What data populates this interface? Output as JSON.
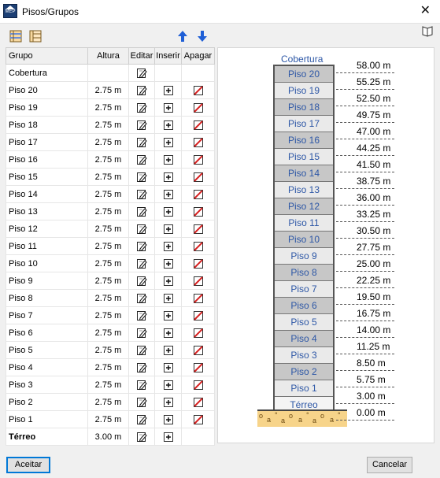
{
  "window": {
    "title": "Pisos/Grupos",
    "app_icon_text": "CYPE\nMEP"
  },
  "grid": {
    "headers": {
      "grupo": "Grupo",
      "altura": "Altura",
      "editar": "Editar",
      "inserir": "Inserir",
      "apagar": "Apagar"
    },
    "rows": [
      {
        "name": "Cobertura",
        "height": "",
        "bold": false,
        "edit": true,
        "insert": false,
        "delete": false
      },
      {
        "name": "Piso 20",
        "height": "2.75 m",
        "bold": false,
        "edit": true,
        "insert": true,
        "delete": true
      },
      {
        "name": "Piso 19",
        "height": "2.75 m",
        "bold": false,
        "edit": true,
        "insert": true,
        "delete": true
      },
      {
        "name": "Piso 18",
        "height": "2.75 m",
        "bold": false,
        "edit": true,
        "insert": true,
        "delete": true
      },
      {
        "name": "Piso 17",
        "height": "2.75 m",
        "bold": false,
        "edit": true,
        "insert": true,
        "delete": true
      },
      {
        "name": "Piso 16",
        "height": "2.75 m",
        "bold": false,
        "edit": true,
        "insert": true,
        "delete": true
      },
      {
        "name": "Piso 15",
        "height": "2.75 m",
        "bold": false,
        "edit": true,
        "insert": true,
        "delete": true
      },
      {
        "name": "Piso 14",
        "height": "2.75 m",
        "bold": false,
        "edit": true,
        "insert": true,
        "delete": true
      },
      {
        "name": "Piso 13",
        "height": "2.75 m",
        "bold": false,
        "edit": true,
        "insert": true,
        "delete": true
      },
      {
        "name": "Piso 12",
        "height": "2.75 m",
        "bold": false,
        "edit": true,
        "insert": true,
        "delete": true
      },
      {
        "name": "Piso 11",
        "height": "2.75 m",
        "bold": false,
        "edit": true,
        "insert": true,
        "delete": true
      },
      {
        "name": "Piso 10",
        "height": "2.75 m",
        "bold": false,
        "edit": true,
        "insert": true,
        "delete": true
      },
      {
        "name": "Piso 9",
        "height": "2.75 m",
        "bold": false,
        "edit": true,
        "insert": true,
        "delete": true
      },
      {
        "name": "Piso 8",
        "height": "2.75 m",
        "bold": false,
        "edit": true,
        "insert": true,
        "delete": true
      },
      {
        "name": "Piso 7",
        "height": "2.75 m",
        "bold": false,
        "edit": true,
        "insert": true,
        "delete": true
      },
      {
        "name": "Piso 6",
        "height": "2.75 m",
        "bold": false,
        "edit": true,
        "insert": true,
        "delete": true
      },
      {
        "name": "Piso 5",
        "height": "2.75 m",
        "bold": false,
        "edit": true,
        "insert": true,
        "delete": true
      },
      {
        "name": "Piso 4",
        "height": "2.75 m",
        "bold": false,
        "edit": true,
        "insert": true,
        "delete": true
      },
      {
        "name": "Piso 3",
        "height": "2.75 m",
        "bold": false,
        "edit": true,
        "insert": true,
        "delete": true
      },
      {
        "name": "Piso 2",
        "height": "2.75 m",
        "bold": false,
        "edit": true,
        "insert": true,
        "delete": true
      },
      {
        "name": "Piso 1",
        "height": "2.75 m",
        "bold": false,
        "edit": true,
        "insert": true,
        "delete": true
      },
      {
        "name": "Térreo",
        "height": "3.00 m",
        "bold": true,
        "edit": true,
        "insert": true,
        "delete": false
      }
    ]
  },
  "diagram": {
    "top_label": "Cobertura",
    "levels": [
      {
        "label": "Cobertura",
        "value": "58.00 m"
      },
      {
        "label": "Piso 20",
        "value": "55.25 m"
      },
      {
        "label": "Piso 19",
        "value": "52.50 m"
      },
      {
        "label": "Piso 18",
        "value": "49.75 m"
      },
      {
        "label": "Piso 17",
        "value": "47.00 m"
      },
      {
        "label": "Piso 16",
        "value": "44.25 m"
      },
      {
        "label": "Piso 15",
        "value": "41.50 m"
      },
      {
        "label": "Piso 14",
        "value": "38.75 m"
      },
      {
        "label": "Piso 13",
        "value": "36.00 m"
      },
      {
        "label": "Piso 12",
        "value": "33.25 m"
      },
      {
        "label": "Piso 11",
        "value": "30.50 m"
      },
      {
        "label": "Piso 10",
        "value": "27.75 m"
      },
      {
        "label": "Piso 9",
        "value": "25.00 m"
      },
      {
        "label": "Piso 8",
        "value": "22.25 m"
      },
      {
        "label": "Piso 7",
        "value": "19.50 m"
      },
      {
        "label": "Piso 6",
        "value": "16.75 m"
      },
      {
        "label": "Piso 5",
        "value": "14.00 m"
      },
      {
        "label": "Piso 4",
        "value": "11.25 m"
      },
      {
        "label": "Piso 3",
        "value": "8.50 m"
      },
      {
        "label": "Piso 2",
        "value": "5.75 m"
      },
      {
        "label": "Piso 1",
        "value": "3.00 m"
      },
      {
        "label": "Térreo",
        "value": "0.00 m"
      }
    ]
  },
  "buttons": {
    "accept": "Aceitar",
    "cancel": "Cancelar"
  },
  "colors": {
    "floor_dark": "#c7c7c7",
    "floor_light": "#eaeaea",
    "label_blue": "#2d57a6",
    "ground": "#f7d48a",
    "arrow_blue": "#1f5fd6",
    "delete_red": "#d61f1f"
  }
}
